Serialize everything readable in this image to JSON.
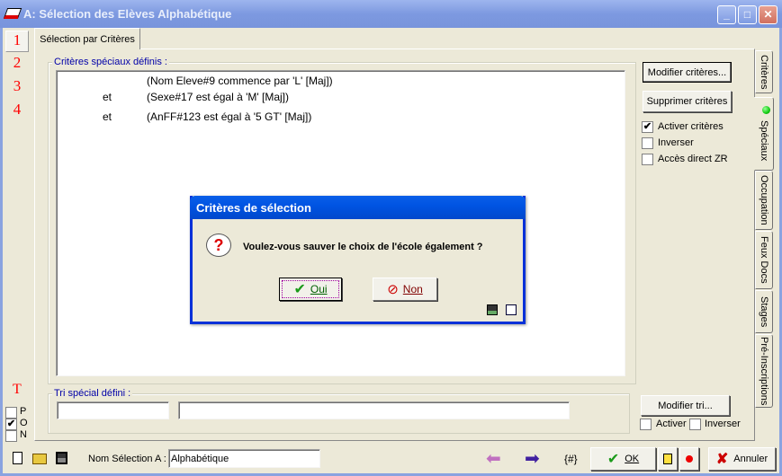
{
  "window": {
    "title": "A: Sélection des Elèves Alphabétique",
    "minimize": "_",
    "maximize": "□",
    "close": "✕"
  },
  "left_numbers": [
    "1",
    "2",
    "3",
    "4"
  ],
  "left_bottom": {
    "t_label": "T",
    "options": [
      {
        "label": "P",
        "checked": false
      },
      {
        "label": "O",
        "checked": true
      },
      {
        "label": "N",
        "checked": false
      }
    ]
  },
  "tab": "Sélection par Critères",
  "criteria": {
    "label": "Critères spéciaux définis :",
    "rows": [
      {
        "op": "",
        "text": "(Nom Eleve#9 commence par 'L' [Maj])"
      },
      {
        "op": "et",
        "text": "(Sexe#17 est égal à 'M' [Maj])"
      },
      {
        "op": "et",
        "text": "(AnFF#123 est égal à '5 GT' [Maj])"
      }
    ]
  },
  "right": {
    "modify": "Modifier critères...",
    "delete": "Supprimer critères",
    "checks": [
      {
        "label": "Activer critères",
        "checked": true
      },
      {
        "label": "Inverser",
        "checked": false
      },
      {
        "label": "Accès direct ZR",
        "checked": false
      }
    ]
  },
  "vtabs": [
    {
      "label": "Critères"
    },
    {
      "label": "Spéciaux",
      "active": true,
      "indicator": "#22CC22"
    },
    {
      "label": "Occupation"
    },
    {
      "label": "Feux Docs"
    },
    {
      "label": "Stages"
    },
    {
      "label": "Pré-Inscriptions"
    }
  ],
  "sort": {
    "label": "Tri spécial défini :",
    "field1": "",
    "field2": "",
    "modify": "Modifier tri...",
    "activate": "Activer",
    "invert": "Inverser"
  },
  "bottom": {
    "name_label": "Nom Sélection A :",
    "name_value": "Alphabétique",
    "hash": "{#}",
    "ok": "OK",
    "cancel": "Annuler"
  },
  "dialog": {
    "title": "Critères de sélection",
    "message": "Voulez-vous sauver le choix de l'école également ?",
    "yes": "Oui",
    "no": "Non"
  },
  "colors": {
    "accent": "#0054E3",
    "red": "#FF0000",
    "label_blue": "#0000A8"
  }
}
